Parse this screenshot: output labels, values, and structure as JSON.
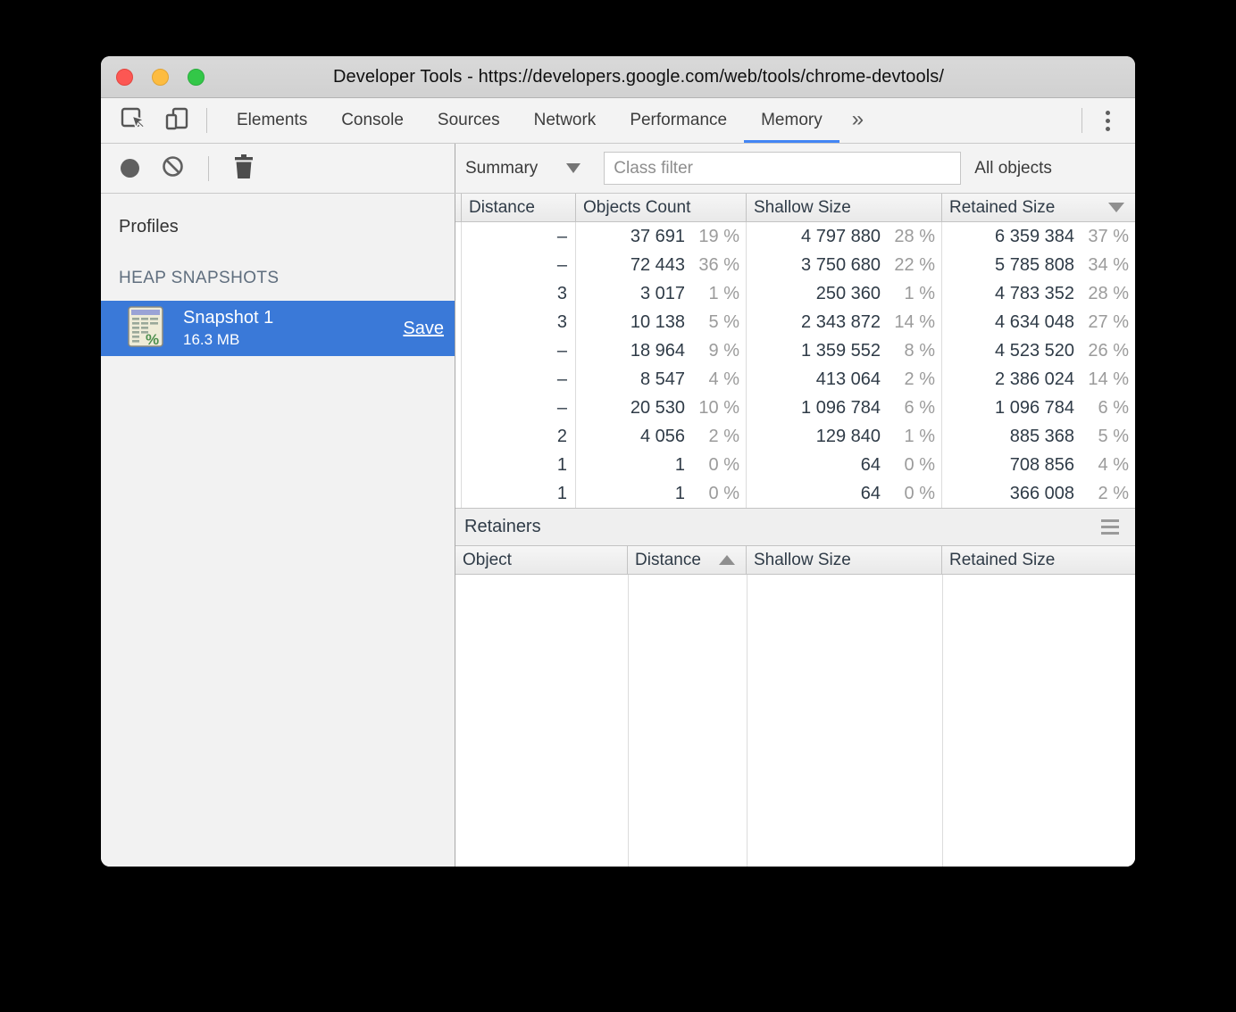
{
  "window": {
    "title": "Developer Tools - https://developers.google.com/web/tools/chrome-devtools/"
  },
  "tabs": {
    "items": [
      "Elements",
      "Console",
      "Sources",
      "Network",
      "Performance",
      "Memory"
    ],
    "active": "Memory",
    "overflow_glyph": "»"
  },
  "toolbar": {
    "summary_label": "Summary",
    "class_filter_placeholder": "Class filter",
    "class_filter_value": "",
    "all_objects_label": "All objects"
  },
  "sidebar": {
    "profiles_label": "Profiles",
    "section_heading": "HEAP SNAPSHOTS",
    "snapshot": {
      "name": "Snapshot 1",
      "size": "16.3 MB",
      "save_label": "Save"
    }
  },
  "heap_table": {
    "columns": [
      "Distance",
      "Objects Count",
      "Shallow Size",
      "Retained Size"
    ],
    "sort": {
      "column": "Retained Size",
      "direction": "desc"
    },
    "rows": [
      {
        "distance": "–",
        "objects_count": "37 691",
        "objects_pct": "19 %",
        "shallow_size": "4 797 880",
        "shallow_pct": "28 %",
        "retained_size": "6 359 384",
        "retained_pct": "37 %"
      },
      {
        "distance": "–",
        "objects_count": "72 443",
        "objects_pct": "36 %",
        "shallow_size": "3 750 680",
        "shallow_pct": "22 %",
        "retained_size": "5 785 808",
        "retained_pct": "34 %"
      },
      {
        "distance": "3",
        "objects_count": "3 017",
        "objects_pct": "1 %",
        "shallow_size": "250 360",
        "shallow_pct": "1 %",
        "retained_size": "4 783 352",
        "retained_pct": "28 %"
      },
      {
        "distance": "3",
        "objects_count": "10 138",
        "objects_pct": "5 %",
        "shallow_size": "2 343 872",
        "shallow_pct": "14 %",
        "retained_size": "4 634 048",
        "retained_pct": "27 %"
      },
      {
        "distance": "–",
        "objects_count": "18 964",
        "objects_pct": "9 %",
        "shallow_size": "1 359 552",
        "shallow_pct": "8 %",
        "retained_size": "4 523 520",
        "retained_pct": "26 %"
      },
      {
        "distance": "–",
        "objects_count": "8 547",
        "objects_pct": "4 %",
        "shallow_size": "413 064",
        "shallow_pct": "2 %",
        "retained_size": "2 386 024",
        "retained_pct": "14 %"
      },
      {
        "distance": "–",
        "objects_count": "20 530",
        "objects_pct": "10 %",
        "shallow_size": "1 096 784",
        "shallow_pct": "6 %",
        "retained_size": "1 096 784",
        "retained_pct": "6 %"
      },
      {
        "distance": "2",
        "objects_count": "4 056",
        "objects_pct": "2 %",
        "shallow_size": "129 840",
        "shallow_pct": "1 %",
        "retained_size": "885 368",
        "retained_pct": "5 %"
      },
      {
        "distance": "1",
        "objects_count": "1",
        "objects_pct": "0 %",
        "shallow_size": "64",
        "shallow_pct": "0 %",
        "retained_size": "708 856",
        "retained_pct": "4 %"
      },
      {
        "distance": "1",
        "objects_count": "1",
        "objects_pct": "0 %",
        "shallow_size": "64",
        "shallow_pct": "0 %",
        "retained_size": "366 008",
        "retained_pct": "2 %"
      }
    ]
  },
  "retainers": {
    "title": "Retainers",
    "columns": [
      "Object",
      "Distance",
      "Shallow Size",
      "Retained Size"
    ],
    "sort": {
      "column": "Distance",
      "direction": "asc"
    },
    "rows": []
  },
  "colors": {
    "selection_blue": "#3a79d8",
    "active_tab_accent": "#4285f4",
    "percent_gray": "#9b9b9b",
    "table_text": "#2f3b47"
  }
}
